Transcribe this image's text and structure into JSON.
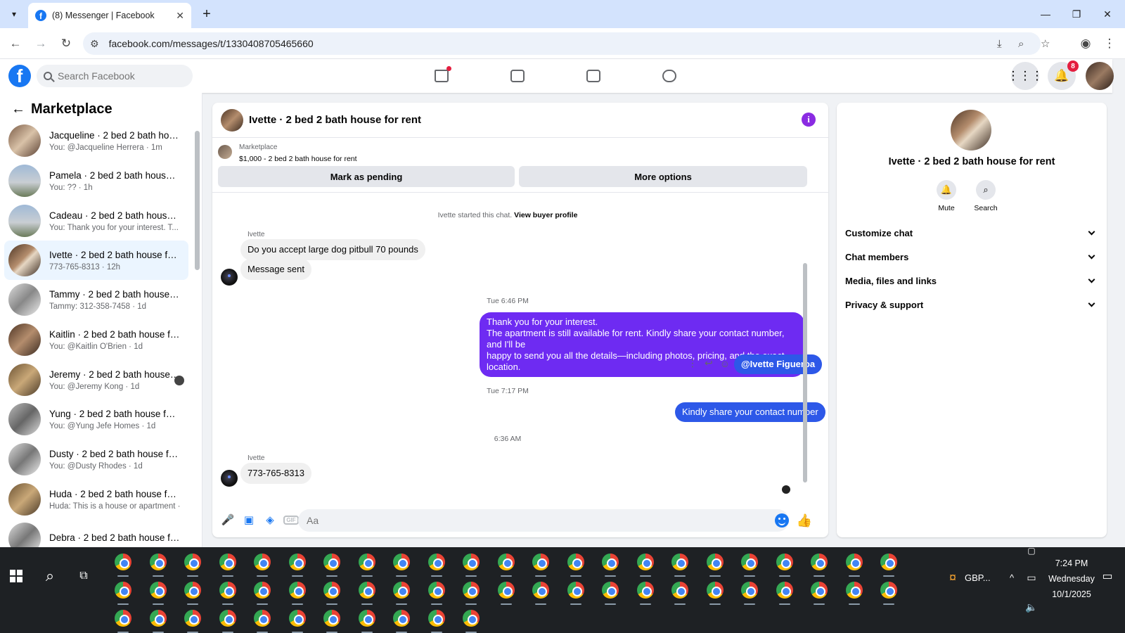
{
  "browser": {
    "tab_title": "(8) Messenger | Facebook",
    "url": "facebook.com/messages/t/1330408705465660"
  },
  "fb": {
    "search_placeholder": "Search Facebook",
    "notification_count": "8"
  },
  "sidebar": {
    "title": "Marketplace",
    "conversations": [
      {
        "name": "Jacqueline · 2 bed 2 bath house...",
        "preview": "You: @Jacqueline Herrera · 1m"
      },
      {
        "name": "Pamela · 2 bed 2 bath house for...",
        "preview": "You: ?? · 1h"
      },
      {
        "name": "Cadeau · 2 bed 2 bath house fo...",
        "preview": "You: Thank you for your interest. T... · 1h"
      },
      {
        "name": "Ivette · 2 bed 2 bath house for r...",
        "preview": "773-765-8313 · 12h"
      },
      {
        "name": "Tammy · 2 bed 2 bath house for...",
        "preview": "Tammy: 312-358-7458 · 1d"
      },
      {
        "name": "Kaitlin · 2 bed 2 bath house for ...",
        "preview": "You: @Kaitlin O'Brien · 1d"
      },
      {
        "name": "Jeremy · 2 bed 2 bath house f...",
        "preview": "You: @Jeremy Kong · 1d"
      },
      {
        "name": "Yung · 2 bed 2 bath house for r...",
        "preview": "You: @Yung Jefe Homes · 1d"
      },
      {
        "name": "Dusty · 2 bed 2 bath house for r...",
        "preview": "You: @Dusty Rhodes · 1d"
      },
      {
        "name": "Huda · 2 bed 2 bath house for r...",
        "preview": "Huda: This is a house or apartment · 1d"
      },
      {
        "name": "Debra · 2 bed 2 bath house for ...",
        "preview": ""
      }
    ]
  },
  "chat": {
    "title": "Ivette · 2 bed 2 bath house for rent",
    "marketplace_label": "Marketplace",
    "listing": "$1,000 - 2 bed 2 bath house for rent",
    "btn_pending": "Mark as pending",
    "btn_more": "More options",
    "started_text": "Ivette started this chat.",
    "view_profile": "View buyer profile",
    "sender_name": "Ivette",
    "msg_in_1": "Do you accept large dog pitbull 70 pounds",
    "msg_in_2": "Message sent",
    "time_1": "Tue 6:46 PM",
    "msg_out_1_line1": "Thank you for your interest.",
    "msg_out_1_line2": "The apartment is still available for rent. Kindly share your contact number, and I'll be",
    "msg_out_1_line3": "happy to send you all the details—including photos, pricing, and the exact location.",
    "mention": "@Ivette Figueroa",
    "time_2": "Tue 7:17 PM",
    "msg_out_2": "Kindly share your contact number",
    "time_3": "6:36 AM",
    "msg_in_3": "773-765-8313",
    "composer_placeholder": "Aa"
  },
  "info": {
    "title": "Ivette · 2 bed 2 bath house for rent",
    "mute": "Mute",
    "search": "Search",
    "rows": [
      "Customize chat",
      "Chat members",
      "Media, files and links",
      "Privacy & support"
    ]
  },
  "taskbar": {
    "currency": "GBP...",
    "time": "7:24 PM",
    "day": "Wednesday",
    "date": "10/1/2025"
  }
}
